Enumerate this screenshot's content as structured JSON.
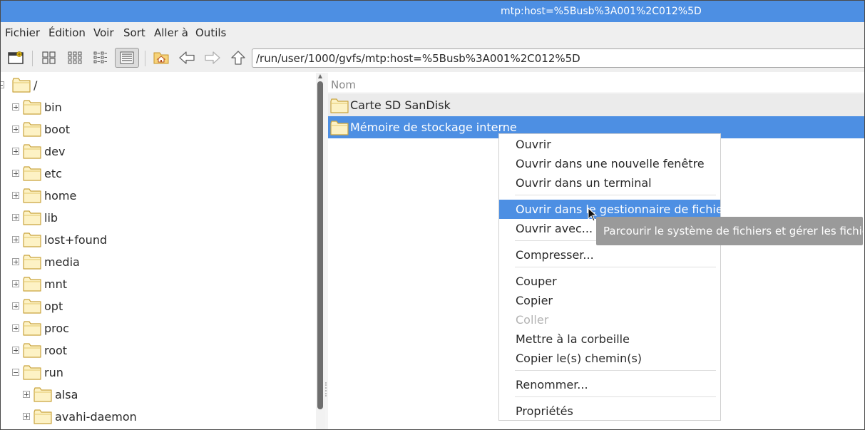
{
  "window": {
    "title": "mtp:host=%5Busb%3A001%2C012%5D",
    "accent": "#4d8fe3"
  },
  "menubar": {
    "items": [
      "Fichier",
      "Édition",
      "Voir",
      "Sort",
      "Aller à",
      "Outils"
    ]
  },
  "toolbar": {
    "buttons": [
      "new-window-icon",
      "icon-view-icon",
      "thumbnail-view-icon",
      "compact-view-icon",
      "detailed-list-view-icon",
      "home-icon",
      "back-arrow-icon",
      "forward-arrow-icon",
      "up-arrow-icon"
    ],
    "active_view": "detailed-list-view",
    "path": "/run/user/1000/gvfs/mtp:host=%5Busb%3A001%2C012%5D"
  },
  "tree": {
    "root": "/",
    "items": [
      {
        "label": "bin",
        "expanded": false
      },
      {
        "label": "boot",
        "expanded": false
      },
      {
        "label": "dev",
        "expanded": false
      },
      {
        "label": "etc",
        "expanded": false
      },
      {
        "label": "home",
        "expanded": false
      },
      {
        "label": "lib",
        "expanded": false
      },
      {
        "label": "lost+found",
        "expanded": false
      },
      {
        "label": "media",
        "expanded": false
      },
      {
        "label": "mnt",
        "expanded": false
      },
      {
        "label": "opt",
        "expanded": false
      },
      {
        "label": "proc",
        "expanded": false
      },
      {
        "label": "root",
        "expanded": false
      },
      {
        "label": "run",
        "expanded": true
      }
    ],
    "run_children": [
      {
        "label": "alsa",
        "expanded": false
      },
      {
        "label": "avahi-daemon",
        "expanded": false
      }
    ]
  },
  "files": {
    "column_name": "Nom",
    "rows": [
      {
        "label": "Carte SD SanDisk",
        "selected": false
      },
      {
        "label": "Mémoire de stockage interne",
        "selected": true
      }
    ]
  },
  "context_menu": {
    "items": [
      {
        "label": "Ouvrir",
        "state": "normal"
      },
      {
        "label": "Ouvrir dans une nouvelle fenêtre",
        "state": "normal"
      },
      {
        "label": "Ouvrir dans un terminal",
        "state": "normal"
      },
      {
        "label": "Ouvrir dans le gestionnaire de fichiers",
        "state": "highlighted"
      },
      {
        "label": "Ouvrir avec...",
        "state": "normal"
      },
      {
        "label": "Compresser...",
        "state": "normal"
      },
      {
        "label": "Couper",
        "state": "normal"
      },
      {
        "label": "Copier",
        "state": "normal"
      },
      {
        "label": "Coller",
        "state": "disabled"
      },
      {
        "label": "Mettre à la corbeille",
        "state": "normal"
      },
      {
        "label": "Copier le(s) chemin(s)",
        "state": "normal"
      },
      {
        "label": "Renommer...",
        "state": "normal"
      },
      {
        "label": "Propriétés",
        "state": "normal"
      }
    ]
  },
  "tooltip": {
    "text": "Parcourir le système de fichiers et gérer les fichiers"
  }
}
